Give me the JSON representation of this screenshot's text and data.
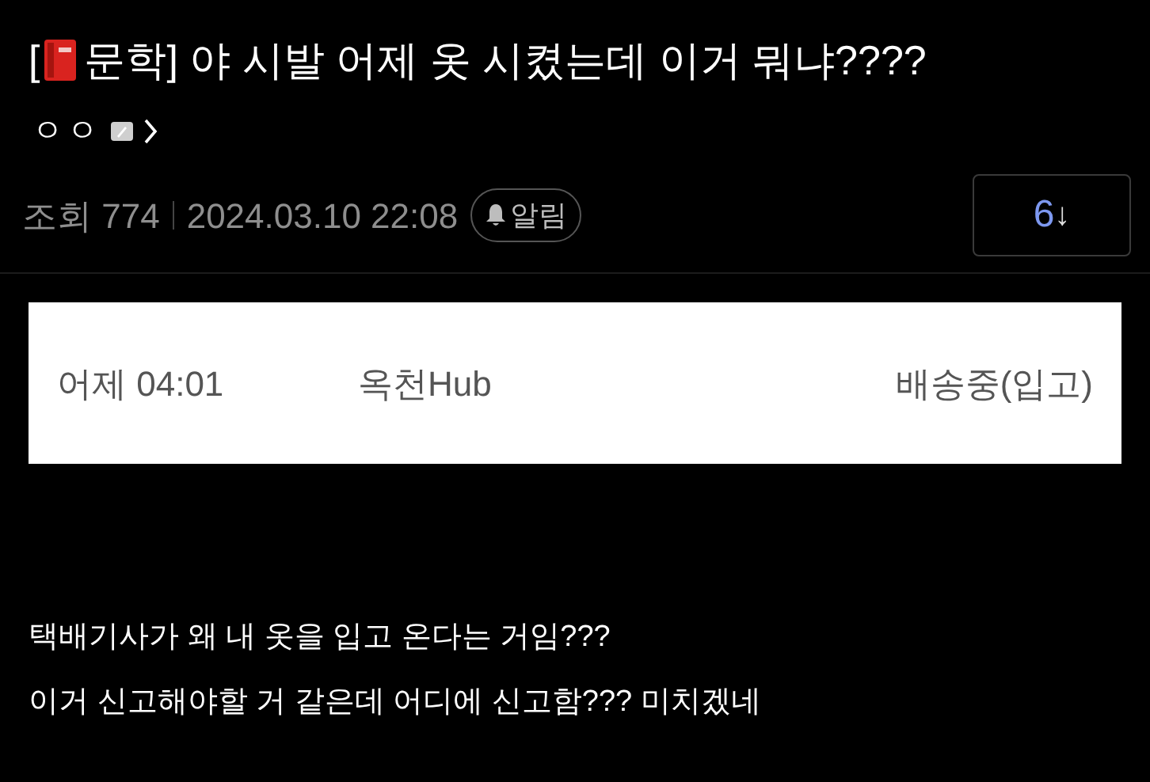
{
  "post": {
    "title_open": "[",
    "title_category": "문학]",
    "title": "야 시발 어제 옷 시켰는데 이거 뭐냐????",
    "author": "ㅇㅇ",
    "views": "조회 774",
    "date": "2024.03.10 22:08",
    "alert_button": "알림",
    "comment_count": "6",
    "comment_arrow": "↓"
  },
  "image": {
    "rows": [
      {
        "time": "어제 04:01",
        "location": "옥천Hub",
        "status": "배송중(입고)"
      }
    ]
  },
  "body": [
    "택배기사가 왜 내 옷을 입고 온다는 거임???",
    "이거 신고해야할 거 같은데 어디에 신고함??? 미치겠네"
  ]
}
